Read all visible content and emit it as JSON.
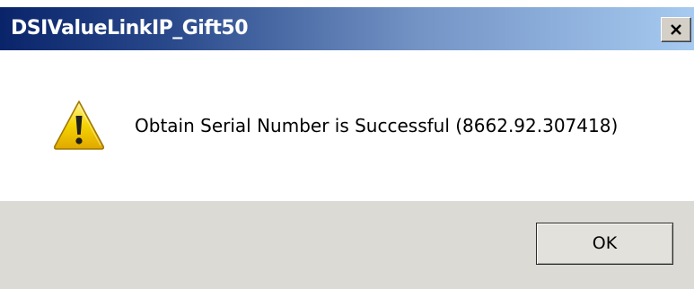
{
  "window": {
    "title": "DSIValueLinkIP_Gift50",
    "close_label": "X"
  },
  "message": {
    "icon": "warning-icon",
    "text": "Obtain Serial Number is Successful (8662.92.307418)"
  },
  "buttons": {
    "ok_label": "OK"
  },
  "colors": {
    "titlebar_start": "#0a246a",
    "titlebar_end": "#a6caf0",
    "footer_bg": "#dcdad5",
    "warning_yellow": "#f5d400"
  }
}
